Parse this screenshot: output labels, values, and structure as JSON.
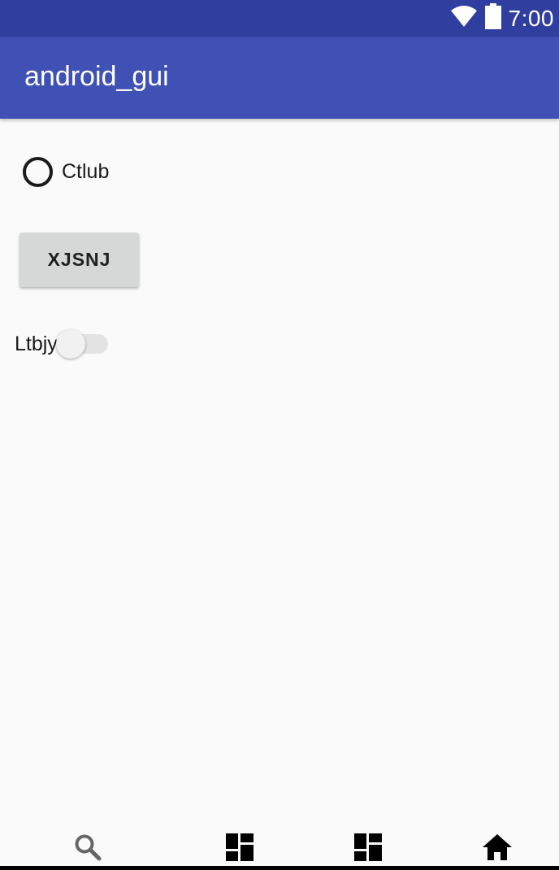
{
  "status_bar": {
    "time": "7:00",
    "background": "#303f9f",
    "icons": [
      "wifi-icon",
      "battery-icon"
    ]
  },
  "app_bar": {
    "title": "android_gui",
    "background": "#3f51b5"
  },
  "radio": {
    "label": "Ctlub",
    "checked": false
  },
  "button": {
    "label": "XJSNJ"
  },
  "switch": {
    "label": "Ltbjy",
    "on": false
  },
  "bottom_nav": {
    "items": [
      {
        "icon": "search-icon",
        "active": false
      },
      {
        "icon": "dashboard-icon",
        "active": false
      },
      {
        "icon": "dashboard-icon",
        "active": false
      },
      {
        "icon": "home-icon",
        "active": true
      }
    ]
  }
}
